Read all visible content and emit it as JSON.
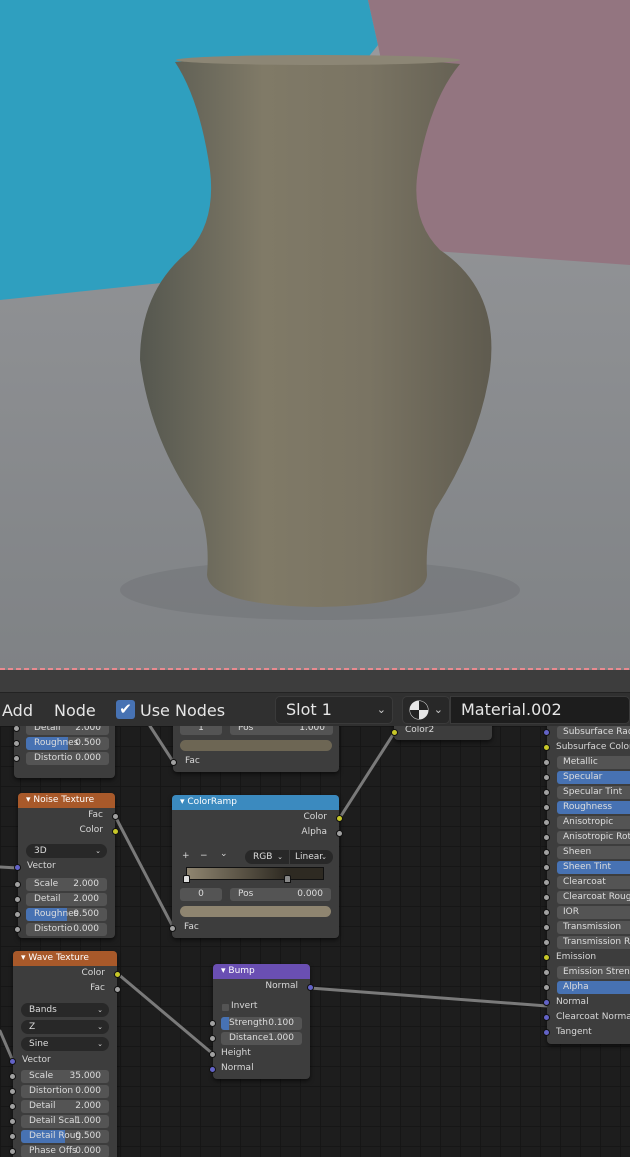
{
  "viewport": {
    "description": "rendered vase preview",
    "colors": {
      "wall_left": "#2f9fbf",
      "wall_right": "#937580",
      "floor": "#8f9093",
      "vase": "#77705f"
    }
  },
  "toolbar": {
    "add_label": "Add",
    "node_label": "Node",
    "use_nodes_label": "Use Nodes",
    "use_nodes_checked": true,
    "slot_label": "Slot 1",
    "material_icon": "material-sphere-icon",
    "material_name": "Material.002"
  },
  "nodes": {
    "top_noise": {
      "fields": [
        {
          "label": "Detail",
          "value": "2.000"
        },
        {
          "label": "Roughnes",
          "value": "0.500",
          "fill": 0.5
        },
        {
          "label": "Distortio",
          "value": "0.000"
        }
      ]
    },
    "top_colorramp": {
      "stop_index": "1",
      "pos_label": "Pos",
      "pos_value": "1.000",
      "output": "Fac"
    },
    "mix_partial": {
      "input": "Color2"
    },
    "noise": {
      "title": "Noise Texture",
      "outputs": [
        "Fac",
        "Color"
      ],
      "dimension": "3D",
      "vector_label": "Vector",
      "fields": [
        {
          "label": "Scale",
          "value": "2.000"
        },
        {
          "label": "Detail",
          "value": "2.000"
        },
        {
          "label": "Roughnes",
          "value": "0.500",
          "fill": 0.5
        },
        {
          "label": "Distortio",
          "value": "0.000"
        }
      ]
    },
    "colorramp": {
      "title": "ColorRamp",
      "outputs": [
        "Color",
        "Alpha"
      ],
      "add": "+",
      "remove": "−",
      "menu": "⌄",
      "color_mode": "RGB",
      "interpolation": "Linear",
      "stops": [
        {
          "pos": 0.0,
          "color": "#8f8570"
        },
        {
          "pos": 0.73,
          "color": "#2e2a22"
        }
      ],
      "stop_index": "0",
      "pos_label": "Pos",
      "pos_value": "0.000",
      "stop_color": "#8f8570",
      "input": "Fac"
    },
    "wave": {
      "title": "Wave Texture",
      "outputs": [
        "Color",
        "Fac"
      ],
      "type": "Bands",
      "direction": "Z",
      "profile": "Sine",
      "vector_label": "Vector",
      "fields": [
        {
          "label": "Scale",
          "value": "35.000"
        },
        {
          "label": "Distortion",
          "value": "0.000"
        },
        {
          "label": "Detail",
          "value": "2.000"
        },
        {
          "label": "Detail Scal",
          "value": "1.000"
        },
        {
          "label": "Detail Roug",
          "value": "0.500",
          "fill": 0.5
        },
        {
          "label": "Phase Offs",
          "value": "0.000"
        }
      ]
    },
    "bump": {
      "title": "Bump",
      "output": "Normal",
      "invert_label": "Invert",
      "fields": [
        {
          "label": "Strength",
          "value": "0.100",
          "fill": 0.1
        },
        {
          "label": "Distance",
          "value": "1.000"
        }
      ],
      "inputs": [
        "Height",
        "Normal"
      ]
    },
    "bsdf": {
      "rows": [
        {
          "label": "Subsurface Radius",
          "socket": "blue",
          "field": true,
          "on": false
        },
        {
          "label": "Subsurface Color",
          "socket": "yellow",
          "field": false,
          "on": false
        },
        {
          "label": "Metallic",
          "socket": "grey",
          "field": true,
          "on": false
        },
        {
          "label": "Specular",
          "socket": "grey",
          "field": true,
          "on": true
        },
        {
          "label": "Specular Tint",
          "socket": "grey",
          "field": true,
          "on": false
        },
        {
          "label": "Roughness",
          "socket": "grey",
          "field": true,
          "on": true
        },
        {
          "label": "Anisotropic",
          "socket": "grey",
          "field": true,
          "on": false
        },
        {
          "label": "Anisotropic Rotation",
          "socket": "grey",
          "field": true,
          "on": false
        },
        {
          "label": "Sheen",
          "socket": "grey",
          "field": true,
          "on": false
        },
        {
          "label": "Sheen Tint",
          "socket": "grey",
          "field": true,
          "on": true
        },
        {
          "label": "Clearcoat",
          "socket": "grey",
          "field": true,
          "on": false
        },
        {
          "label": "Clearcoat Roughness",
          "socket": "grey",
          "field": true,
          "on": false
        },
        {
          "label": "IOR",
          "socket": "grey",
          "field": true,
          "on": false
        },
        {
          "label": "Transmission",
          "socket": "grey",
          "field": true,
          "on": false
        },
        {
          "label": "Transmission Roughness",
          "socket": "grey",
          "field": true,
          "on": false
        },
        {
          "label": "Emission",
          "socket": "yellow",
          "field": false,
          "on": false
        },
        {
          "label": "Emission Strength",
          "socket": "grey",
          "field": true,
          "on": false
        },
        {
          "label": "Alpha",
          "socket": "grey",
          "field": true,
          "on": true
        },
        {
          "label": "Normal",
          "socket": "blue",
          "field": false,
          "on": false
        },
        {
          "label": "Clearcoat Normal",
          "socket": "blue",
          "field": false,
          "on": false
        },
        {
          "label": "Tangent",
          "socket": "blue",
          "field": false,
          "on": false
        }
      ]
    }
  },
  "header_colors": {
    "texture": "#a8592a",
    "converter": "#3b8abf",
    "vector": "#6a4fb3",
    "accent": "#4772b3"
  }
}
